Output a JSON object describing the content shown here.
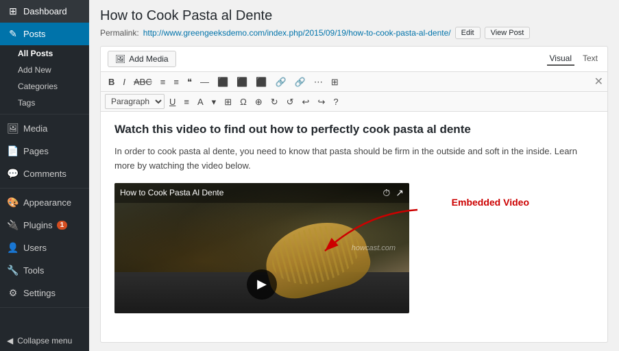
{
  "sidebar": {
    "items": [
      {
        "id": "dashboard",
        "label": "Dashboard",
        "icon": "⊞"
      },
      {
        "id": "posts",
        "label": "Posts",
        "icon": "✎",
        "active": true
      },
      {
        "id": "all-posts",
        "label": "All Posts",
        "sub": true,
        "active": true
      },
      {
        "id": "add-new",
        "label": "Add New",
        "sub": true
      },
      {
        "id": "categories",
        "label": "Categories",
        "sub": true
      },
      {
        "id": "tags",
        "label": "Tags",
        "sub": true
      },
      {
        "id": "media",
        "label": "Media",
        "icon": "🖼"
      },
      {
        "id": "pages",
        "label": "Pages",
        "icon": "📄"
      },
      {
        "id": "comments",
        "label": "Comments",
        "icon": "💬"
      },
      {
        "id": "appearance",
        "label": "Appearance",
        "icon": "🎨"
      },
      {
        "id": "plugins",
        "label": "Plugins",
        "icon": "🔌",
        "badge": "1"
      },
      {
        "id": "users",
        "label": "Users",
        "icon": "👤"
      },
      {
        "id": "tools",
        "label": "Tools",
        "icon": "🔧"
      },
      {
        "id": "settings",
        "label": "Settings",
        "icon": "⚙"
      }
    ],
    "collapse_label": "Collapse menu"
  },
  "post": {
    "title": "How to Cook Pasta al Dente",
    "permalink_label": "Permalink:",
    "permalink_url": "http://www.greengeeksdemo.com/index.php/2015/09/19/how-to-cook-pasta-al-dente/",
    "edit_btn": "Edit",
    "view_post_btn": "View Post"
  },
  "editor": {
    "add_media_label": "Add Media",
    "visual_tab": "Visual",
    "text_tab": "Text",
    "toolbar": {
      "row1": [
        "B",
        "I",
        "ABC",
        "≡",
        "≡",
        "❝",
        "—",
        "≡",
        "≡",
        "≡",
        "🔗",
        "🔗",
        "≡",
        "⊞"
      ],
      "row2_select": "Paragraph",
      "row2_btns": [
        "U",
        "≡",
        "A",
        "▾",
        "⊞",
        "Ω",
        "⊕",
        "↻",
        "↺",
        "↩",
        "↪",
        "?"
      ]
    },
    "heading": "Watch this video to find out how to perfectly cook pasta al dente",
    "paragraph": "In order to cook pasta al dente, you need to know that pasta should be firm in the outside and soft in the inside. Learn more by watching the video below.",
    "video": {
      "title": "How to Cook Pasta Al Dente",
      "watermark": "howcast.com",
      "embedded_label": "Embedded Video"
    }
  }
}
